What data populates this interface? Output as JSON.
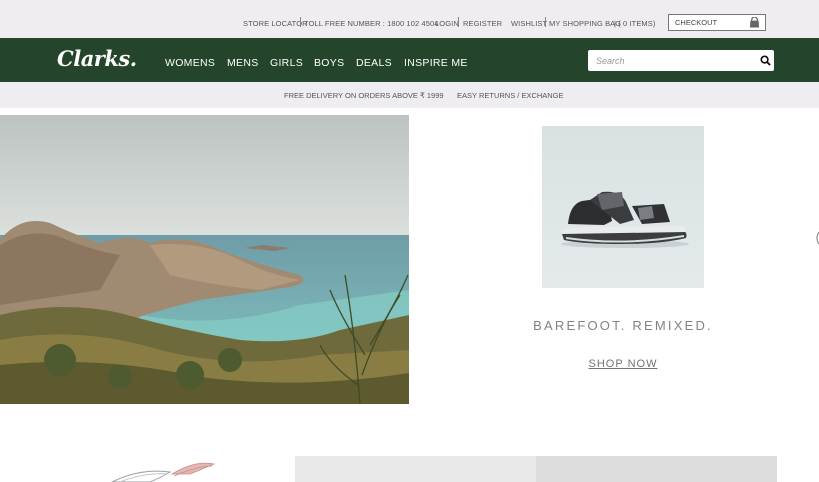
{
  "utility": {
    "store_locator": "STORE LOCATOR",
    "toll_free": "TOLL FREE NUMBER : 1800 102 4504",
    "login": "LOGIN",
    "register": "REGISTER",
    "wishlist": "WISHLIST",
    "shopping_bag": "MY SHOPPING BAG",
    "bag_count": "| ( 0  ITEMS)",
    "checkout": "CHECKOUT"
  },
  "nav": {
    "logo": "Clarks.",
    "items": [
      "WOMENS",
      "MENS",
      "GIRLS",
      "BOYS",
      "DEALS",
      "INSPIRE ME"
    ],
    "search_placeholder": "Search"
  },
  "promo": {
    "delivery": "FREE DELIVERY ON ORDERS ABOVE ₹ 1999",
    "returns": "EASY RETURNS / EXCHANGE"
  },
  "hero": {
    "headline": "BAREFOOT. REMIXED.",
    "cta": "SHOP NOW"
  },
  "icons": {
    "bag": "shopping-bag-icon",
    "search": "magnifier-icon"
  },
  "colors": {
    "nav_bg": "#24442b",
    "utility_bg": "#efedf2"
  }
}
